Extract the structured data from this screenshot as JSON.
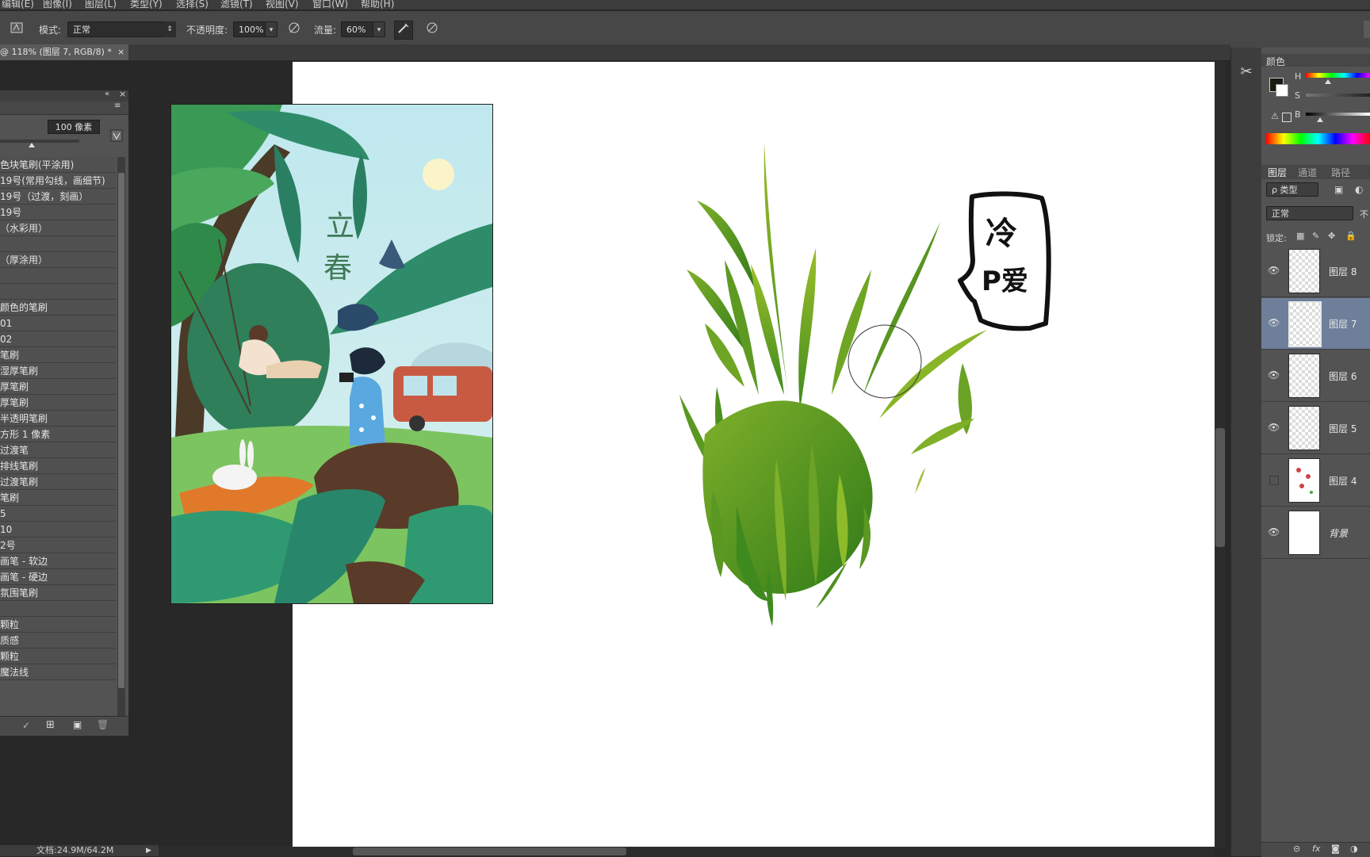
{
  "menu": [
    "编辑(E)",
    "图像(I)",
    "图层(L)",
    "类型(Y)",
    "选择(S)",
    "滤镜(T)",
    "视图(V)",
    "窗口(W)",
    "帮助(H)"
  ],
  "options": {
    "mode_label": "模式:",
    "mode_value": "正常",
    "opacity_label": "不透明度:",
    "opacity_value": "100%",
    "flow_label": "流量:",
    "flow_value": "60%"
  },
  "document_tab": "@ 118% (图层 7, RGB/8) *",
  "brush_panel": {
    "size_value": "100 像素",
    "items": [
      "色块笔刷(平涂用)",
      "19号(常用勾线，画细节)",
      "19号（过渡，刻画）",
      "19号",
      "（水彩用）",
      "",
      "（厚涂用）",
      "",
      "",
      "颜色的笔刷",
      "01",
      "02",
      "笔刷",
      "湿厚笔刷",
      "厚笔刷",
      "厚笔刷",
      "半透明笔刷",
      "方形 1 像素",
      "过渡笔",
      "排线笔刷",
      "过渡笔刷",
      "笔刷",
      "5",
      "10",
      "2号",
      "画笔 - 软边",
      "画笔 - 硬边",
      "氛围笔刷",
      "",
      "颗粒",
      "质感",
      "颗粒",
      "魔法线"
    ]
  },
  "reference_image": {
    "title_line1": "立",
    "title_line2": "春"
  },
  "speech_bubble": {
    "line1": "冷",
    "line2": "P爱"
  },
  "status": {
    "doc_size": "文档:24.9M/64.2M"
  },
  "color_panel": {
    "title": "颜色",
    "h_label": "H",
    "s_label": "S",
    "b_label": "B"
  },
  "layers_panel": {
    "tabs": [
      "图层",
      "通道",
      "路径"
    ],
    "filter_label": "ρ 类型",
    "blend_mode": "正常",
    "opacity_cut": "不",
    "lock_label": "锁定:",
    "layers": [
      {
        "name": "图层 8",
        "visible": true,
        "selected": false
      },
      {
        "name": "图层 7",
        "visible": true,
        "selected": true
      },
      {
        "name": "图层 6",
        "visible": true,
        "selected": false
      },
      {
        "name": "图层 5",
        "visible": true,
        "selected": false
      },
      {
        "name": "图层 4",
        "visible": false,
        "selected": false
      },
      {
        "name": "背景",
        "visible": true,
        "selected": false
      }
    ]
  },
  "colors": {
    "foreground": "#1a1a10",
    "background": "#ffffff",
    "selection": "#6e7f9a",
    "grass_dark": "#3f8a1e",
    "grass_light": "#9cbf2a"
  }
}
